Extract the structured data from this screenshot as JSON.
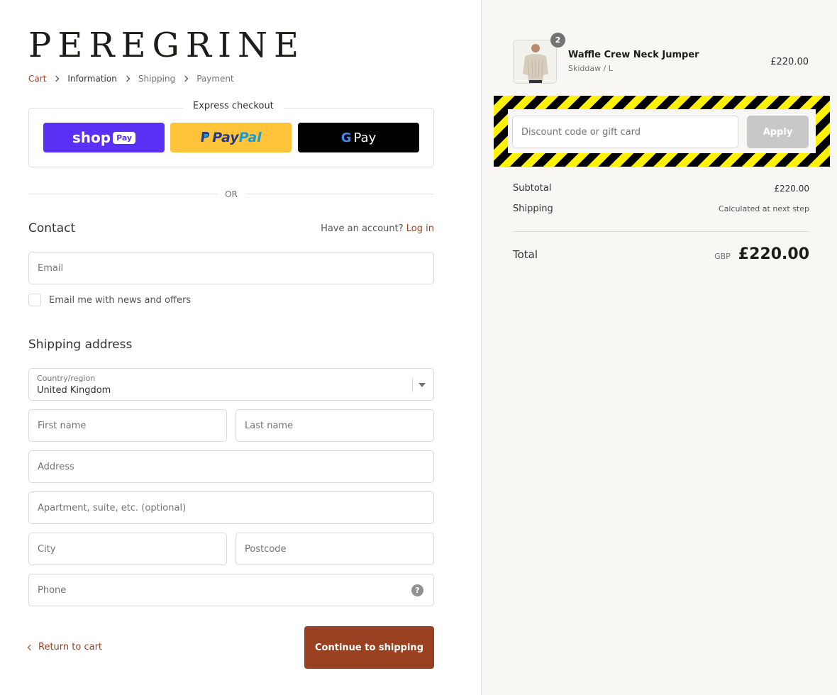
{
  "brand": {
    "logo": "PEREGRINE"
  },
  "breadcrumb": [
    "Cart",
    "Information",
    "Shipping",
    "Payment"
  ],
  "express": {
    "title": "Express checkout",
    "shop": {
      "word": "shop",
      "badge": "Pay"
    },
    "paypal": {
      "part1": "Pay",
      "part2": "Pal"
    },
    "gpay": {
      "g": "G",
      "label": "Pay"
    }
  },
  "divider": "OR",
  "contact": {
    "title": "Contact",
    "account_prompt": "Have an account?",
    "login": "Log in",
    "email_placeholder": "Email",
    "newsletter_label": "Email me with news and offers"
  },
  "shipping": {
    "title": "Shipping address",
    "country_label": "Country/region",
    "country_value": "United Kingdom",
    "first_name": "First name",
    "last_name": "Last name",
    "address": "Address",
    "apartment": "Apartment, suite, etc. (optional)",
    "city": "City",
    "postcode": "Postcode",
    "phone": "Phone",
    "help": "?"
  },
  "actions": {
    "return": "Return to cart",
    "continue": "Continue to shipping"
  },
  "order": {
    "item": {
      "name": "Waffle Crew Neck Jumper",
      "variant": "Skiddaw / L",
      "price": "£220.00",
      "quantity": "2"
    },
    "discount": {
      "placeholder": "Discount code or gift card",
      "apply": "Apply"
    },
    "subtotal": {
      "label": "Subtotal",
      "value": "£220.00"
    },
    "shipping": {
      "label": "Shipping",
      "value": "Calculated at next step"
    },
    "total": {
      "label": "Total",
      "currency": "GBP",
      "value": "£220.00"
    }
  },
  "colors": {
    "accent": "#98401f",
    "shop_pay": "#5a31f4",
    "paypal": "#ffc439",
    "sidebar_bg": "#f8f7f3",
    "hazard_yellow": "#fff200"
  }
}
